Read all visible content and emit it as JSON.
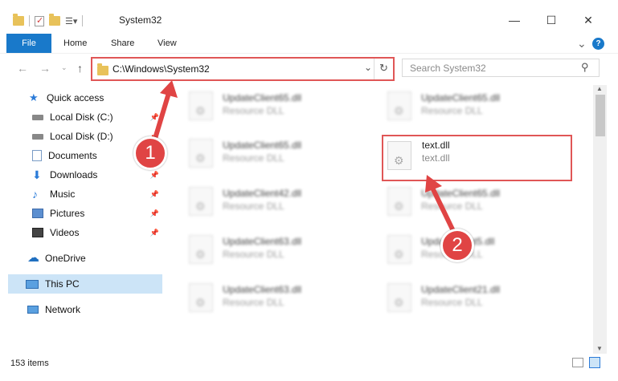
{
  "window": {
    "title": "System32",
    "controls": {
      "minimize": "—",
      "maximize": "☐",
      "close": "✕"
    }
  },
  "ribbon": {
    "tabs": [
      "File",
      "Home",
      "Share",
      "View"
    ],
    "collapse_glyph": "⌄",
    "help_glyph": "?"
  },
  "address": {
    "path": "C:\\Windows\\System32",
    "search_placeholder": "Search System32"
  },
  "nav_pane": {
    "items": [
      {
        "label": "Quick access",
        "icon": "star-icon"
      },
      {
        "label": "Local Disk (C:)",
        "icon": "drive-icon"
      },
      {
        "label": "Local Disk (D:)",
        "icon": "drive-icon"
      },
      {
        "label": "Documents",
        "icon": "documents-icon"
      },
      {
        "label": "Downloads",
        "icon": "downloads-icon"
      },
      {
        "label": "Music",
        "icon": "music-icon"
      },
      {
        "label": "Pictures",
        "icon": "pictures-icon"
      },
      {
        "label": "Videos",
        "icon": "videos-icon"
      },
      {
        "label": "OneDrive",
        "icon": "cloud-icon"
      },
      {
        "label": "This PC",
        "icon": "computer-icon",
        "selected": true
      },
      {
        "label": "Network",
        "icon": "network-icon"
      }
    ]
  },
  "files": [
    {
      "name": "UpdateClient65.dll",
      "type": "Resource DLL"
    },
    {
      "name": "UpdateClient65.dll",
      "type": "Resource DLL"
    },
    {
      "name": "UpdateClient65.dll",
      "type": "Resource DLL"
    },
    {
      "name": "text.dll",
      "type": "text.dll",
      "highlighted": true
    },
    {
      "name": "UpdateClient42.dll",
      "type": "Resource DLL"
    },
    {
      "name": "UpdateClient65.dll",
      "type": "Resource DLL"
    },
    {
      "name": "UpdateClient63.dll",
      "type": "Resource DLL"
    },
    {
      "name": "UpdateClient5.dll",
      "type": "Resource DLL"
    },
    {
      "name": "UpdateClient63.dll",
      "type": "Resource DLL"
    },
    {
      "name": "UpdateClient21.dll",
      "type": "Resource DLL"
    }
  ],
  "status": {
    "item_count": "153 items"
  },
  "annotations": {
    "step1": "1",
    "step2": "2",
    "highlight_color": "#e05656"
  }
}
